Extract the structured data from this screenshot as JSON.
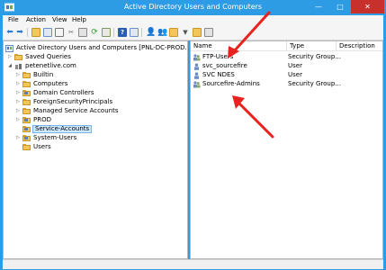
{
  "window": {
    "title": "Active Directory Users and Computers",
    "min": "—",
    "max": "□",
    "close": "✕"
  },
  "menu": [
    "File",
    "Action",
    "View",
    "Help"
  ],
  "tree": {
    "root": "Active Directory Users and Computers [PNL-DC-PROD.petenetli",
    "saved_queries": "Saved Queries",
    "domain": "petenetlive.com",
    "items": [
      "Builtin",
      "Computers",
      "Domain Controllers",
      "ForeignSecurityPrincipals",
      "Managed Service Accounts",
      "PROD",
      "Service-Accounts",
      "System-Users",
      "Users"
    ],
    "selected": "Service-Accounts"
  },
  "columns": {
    "name": "Name",
    "type": "Type",
    "description": "Description"
  },
  "rows": [
    {
      "name": "FTP-Users",
      "type": "Security Group...",
      "icon": "group-icon"
    },
    {
      "name": "svc_sourcefire",
      "type": "User",
      "icon": "user-icon"
    },
    {
      "name": "SVC NDES",
      "type": "User",
      "icon": "user-icon"
    },
    {
      "name": "Sourcefire-Admins",
      "type": "Security Group...",
      "icon": "group-icon"
    }
  ],
  "colors": {
    "title_bar": "#2e9be5",
    "close": "#c7302b",
    "arrow": "#e8231f",
    "selection": "#cde8ff"
  }
}
